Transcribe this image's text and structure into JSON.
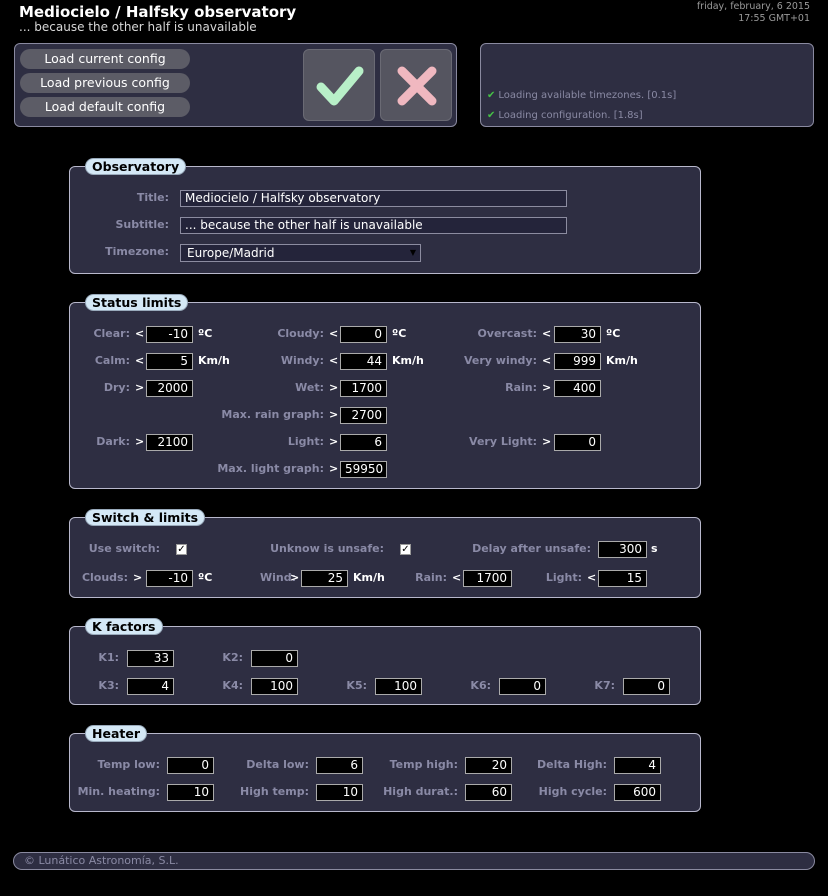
{
  "header": {
    "title": "Mediocielo / Halfsky observatory",
    "subtitle": "... because the other half is unavailable",
    "date": "friday, february, 6 2015",
    "time": "17:55 GMT+01"
  },
  "config": {
    "load_current": "Load current config",
    "load_previous": "Load previous config",
    "load_default": "Load default config",
    "accept_icon": "check-icon",
    "cancel_icon": "cross-icon"
  },
  "log": [
    "Loading available timezones. [0.1s]",
    "Loading configuration. [1.8s]"
  ],
  "observatory": {
    "legend": "Observatory",
    "title_label": "Title:",
    "title_value": "Mediocielo / Halfsky observatory",
    "subtitle_label": "Subtitle:",
    "subtitle_value": "... because the other half is unavailable",
    "timezone_label": "Timezone:",
    "timezone_value": "Europe/Madrid"
  },
  "status": {
    "legend": "Status limits",
    "clear": {
      "label": "Clear:",
      "op": "<",
      "value": "-10",
      "unit": "ºC"
    },
    "cloudy": {
      "label": "Cloudy:",
      "op": "<",
      "value": "0",
      "unit": "ºC"
    },
    "overcast": {
      "label": "Overcast:",
      "op": "<",
      "value": "30",
      "unit": "ºC"
    },
    "calm": {
      "label": "Calm:",
      "op": "<",
      "value": "5",
      "unit": "Km/h"
    },
    "windy": {
      "label": "Windy:",
      "op": "<",
      "value": "44",
      "unit": "Km/h"
    },
    "very_windy": {
      "label": "Very windy:",
      "op": "<",
      "value": "999",
      "unit": "Km/h"
    },
    "dry": {
      "label": "Dry:",
      "op": ">",
      "value": "2000"
    },
    "wet": {
      "label": "Wet:",
      "op": ">",
      "value": "1700"
    },
    "rain": {
      "label": "Rain:",
      "op": ">",
      "value": "400"
    },
    "max_rain": {
      "label": "Max. rain graph:",
      "op": ">",
      "value": "2700"
    },
    "dark": {
      "label": "Dark:",
      "op": ">",
      "value": "2100"
    },
    "light": {
      "label": "Light:",
      "op": ">",
      "value": "6"
    },
    "very_light": {
      "label": "Very Light:",
      "op": ">",
      "value": "0"
    },
    "max_light": {
      "label": "Max. light graph:",
      "op": ">",
      "value": "59950"
    }
  },
  "switch": {
    "legend": "Switch & limits",
    "use_switch": {
      "label": "Use switch:",
      "checked": "✓"
    },
    "unknow_unsafe": {
      "label": "Unknow is unsafe:",
      "checked": "✓"
    },
    "delay": {
      "label": "Delay after unsafe:",
      "value": "300",
      "unit": "s"
    },
    "clouds": {
      "label": "Clouds:",
      "op": ">",
      "value": "-10",
      "unit": "ºC"
    },
    "wind": {
      "label": "Wind:",
      "op": ">",
      "value": "25",
      "unit": "Km/h"
    },
    "rain": {
      "label": "Rain:",
      "op": "<",
      "value": "1700"
    },
    "light": {
      "label": "Light:",
      "op": "<",
      "value": "15"
    }
  },
  "k": {
    "legend": "K factors",
    "k1": {
      "label": "K1:",
      "value": "33"
    },
    "k2": {
      "label": "K2:",
      "value": "0"
    },
    "k3": {
      "label": "K3:",
      "value": "4"
    },
    "k4": {
      "label": "K4:",
      "value": "100"
    },
    "k5": {
      "label": "K5:",
      "value": "100"
    },
    "k6": {
      "label": "K6:",
      "value": "0"
    },
    "k7": {
      "label": "K7:",
      "value": "0"
    }
  },
  "heater": {
    "legend": "Heater",
    "temp_low": {
      "label": "Temp low:",
      "value": "0"
    },
    "delta_low": {
      "label": "Delta low:",
      "value": "6"
    },
    "temp_high": {
      "label": "Temp high:",
      "value": "20"
    },
    "delta_high": {
      "label": "Delta High:",
      "value": "4"
    },
    "min_heating": {
      "label": "Min. heating:",
      "value": "10"
    },
    "high_temp": {
      "label": "High temp:",
      "value": "10"
    },
    "high_durat": {
      "label": "High durat.:",
      "value": "60"
    },
    "high_cycle": {
      "label": "High cycle:",
      "value": "600"
    }
  },
  "footer": "© Lunático Astronomía, S.L."
}
